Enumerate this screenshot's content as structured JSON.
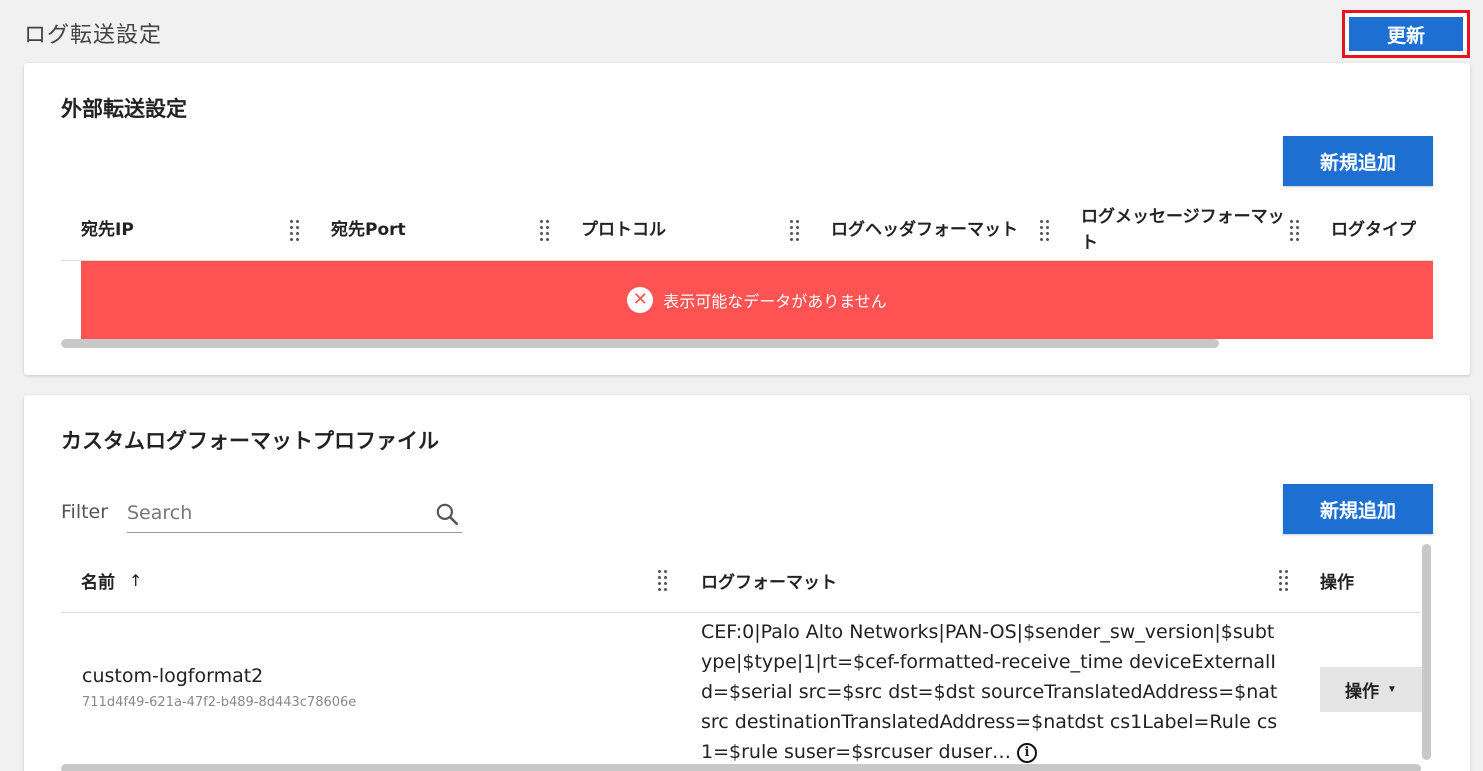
{
  "page": {
    "title": "ログ転送設定",
    "update_label": "更新"
  },
  "external_forwarding": {
    "title": "外部転送設定",
    "add_label": "新規追加",
    "columns": [
      "宛先IP",
      "宛先Port",
      "プロトコル",
      "ログヘッダフォーマット",
      "ログメッセージフォーマット",
      "ログタイプ"
    ],
    "empty_message": "表示可能なデータがありません"
  },
  "custom_profiles": {
    "title": "カスタムログフォーマットプロファイル",
    "add_label": "新規追加",
    "filter_label": "Filter",
    "search_placeholder": "Search",
    "columns": {
      "name": "名前",
      "format": "ログフォーマット",
      "actions": "操作"
    },
    "rows": [
      {
        "name": "custom-logformat2",
        "id": "711d4f49-621a-47f2-b489-8d443c78606e",
        "format": "CEF:0|Palo Alto Networks|PAN-OS|$sender_sw_version|$subtype|$type|1|rt=$cef-formatted-receive_time deviceExternalId=$serial src=$src dst=$dst sourceTranslatedAddress=$natsrc destinationTranslatedAddress=$natdst cs1Label=Rule cs1=$rule suser=$srcuser duser…",
        "action_label": "操作"
      }
    ]
  },
  "colors": {
    "primary": "#1d6fd1",
    "error": "#ff5252",
    "highlight_border": "#e4151f"
  }
}
